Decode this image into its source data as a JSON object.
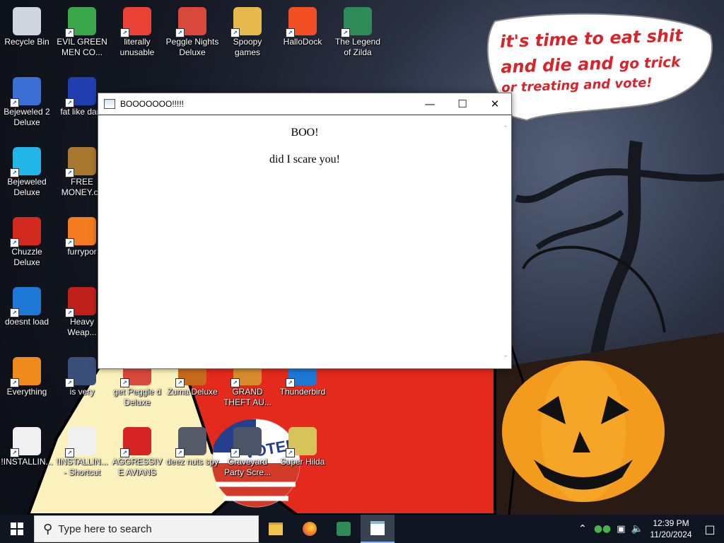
{
  "wallpaper": {
    "speech_bubble_line1": "it's time to eat shit",
    "speech_bubble_line2a": "and die and ",
    "speech_bubble_line2b": "go trick",
    "speech_bubble_line3": "or treating and vote!",
    "sticker_text": "VOTED"
  },
  "desktop_icons": [
    {
      "label": "Recycle Bin",
      "icon": "recycle-bin-icon",
      "color": "#cfd6df"
    },
    {
      "label": "EVIL GREEN MEN CO...",
      "icon": "green-men-icon",
      "color": "#3aa84a"
    },
    {
      "label": "literally unusable",
      "icon": "chrome-icon",
      "color": "#e94235"
    },
    {
      "label": "Peggle Nights Deluxe",
      "icon": "peggle-icon",
      "color": "#d8483b"
    },
    {
      "label": "Spoopy games",
      "icon": "folder-icon",
      "color": "#e7b84c"
    },
    {
      "label": "HalloDock",
      "icon": "windows-logo-icon",
      "color": "#f25022"
    },
    {
      "label": "The Legend of Zilda",
      "icon": "zilda-icon",
      "color": "#2e8b57"
    },
    {
      "label": "Bejeweled 2 Deluxe",
      "icon": "bejeweled-2-icon",
      "color": "#3b6fd6"
    },
    {
      "label": "fat like dark",
      "icon": "mpl-icon",
      "color": "#1f3fb0"
    },
    {
      "label": "Bejeweled Deluxe",
      "icon": "diamond-icon",
      "color": "#22b5e8"
    },
    {
      "label": "FREE MONEY.co",
      "icon": "money-bag-icon",
      "color": "#a8782f"
    },
    {
      "label": "Chuzzle Deluxe",
      "icon": "chuzzle-icon",
      "color": "#d32a1f"
    },
    {
      "label": "furrypor",
      "icon": "firefox-icon",
      "color": "#f47b20"
    },
    {
      "label": "doesnt load",
      "icon": "thunderbird-icon",
      "color": "#1e78d6"
    },
    {
      "label": "Heavy Weap...",
      "icon": "radiation-icon",
      "color": "#c0201a"
    },
    {
      "label": "Everything",
      "icon": "everything-search-icon",
      "color": "#f08a1c"
    },
    {
      "label": "is very",
      "icon": "shield-icon",
      "color": "#3a4e7a"
    },
    {
      "label": "get Peggle d Deluxe",
      "icon": "peggle-icon",
      "color": "#d8483b"
    },
    {
      "label": "Zuma Deluxe",
      "icon": "zuma-icon",
      "color": "#c76a1c"
    },
    {
      "label": "GRAND THEFT AU...",
      "icon": "gta-icon",
      "color": "#d68c2a"
    },
    {
      "label": "Thunderbird",
      "icon": "thunderbird-icon",
      "color": "#1e78d6"
    },
    {
      "label": "!INSTALLIN...",
      "icon": "text-file-icon",
      "color": "#f0f0f0"
    },
    {
      "label": "!INSTALLIN... - Shortcut",
      "icon": "text-file-icon",
      "color": "#f0f0f0"
    },
    {
      "label": "AGGRESSIVE AVIANS",
      "icon": "angry-bird-icon",
      "color": "#d62424"
    },
    {
      "label": "deez nuts spy",
      "icon": "window-stack-icon",
      "color": "#555b66"
    },
    {
      "label": "Graveyard Party Scre...",
      "icon": "graveyard-icon",
      "color": "#4a5568"
    },
    {
      "label": "Super Hilda",
      "icon": "hilda-icon",
      "color": "#d6c45a"
    }
  ],
  "dialog": {
    "title": "BOOOOOOO!!!!!",
    "heading": "BOO!",
    "message": "did I scare you!"
  },
  "taskbar": {
    "search_placeholder": "Type here to search",
    "apps": [
      {
        "name": "file-explorer",
        "icon": "folder-icon"
      },
      {
        "name": "firefox",
        "icon": "firefox-icon"
      },
      {
        "name": "zilda-game",
        "icon": "zilda-icon"
      },
      {
        "name": "dialog-app",
        "icon": "window-icon",
        "active": true
      }
    ],
    "clock_time": "12:39 PM",
    "clock_date": "11/20/2024"
  }
}
